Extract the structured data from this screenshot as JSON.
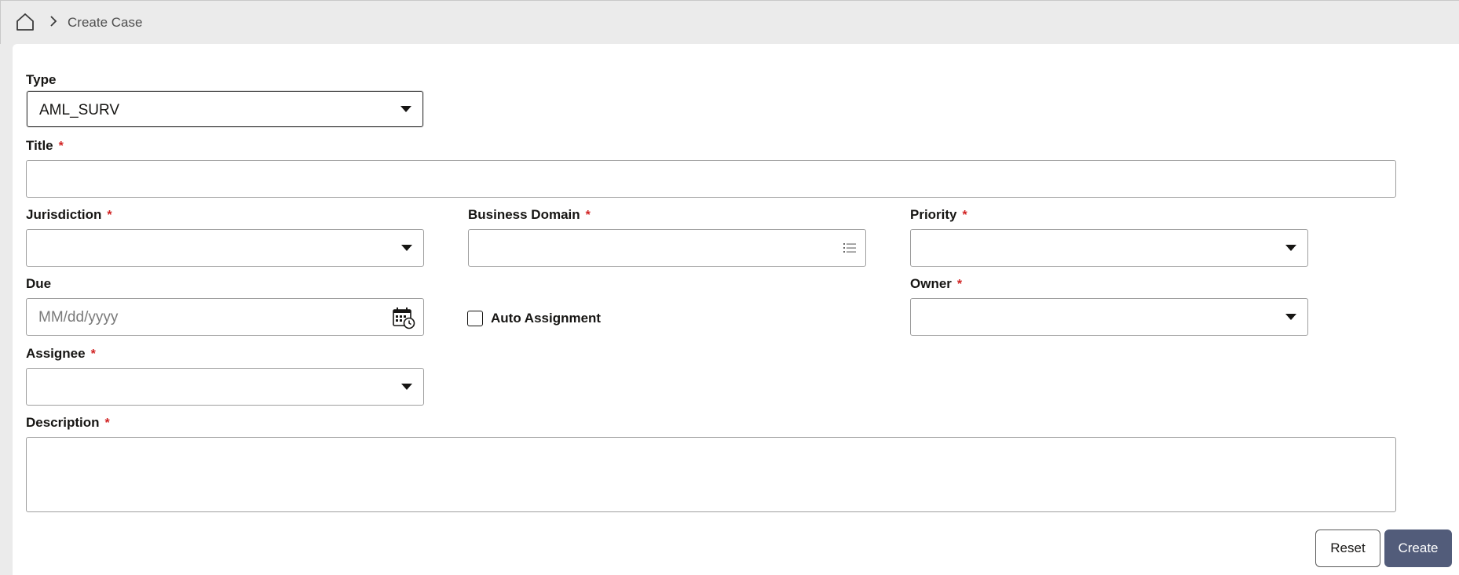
{
  "breadcrumb": {
    "home_icon": "home-icon",
    "separator_icon": "chevron-right-icon",
    "current": "Create Case"
  },
  "form": {
    "type": {
      "label": "Type",
      "value": "AML_SURV"
    },
    "title": {
      "label": "Title",
      "required_mark": "*",
      "value": ""
    },
    "jurisdiction": {
      "label": "Jurisdiction",
      "required_mark": "*",
      "value": ""
    },
    "business_domain": {
      "label": "Business Domain",
      "required_mark": "*",
      "value": ""
    },
    "priority": {
      "label": "Priority",
      "required_mark": "*",
      "value": ""
    },
    "due": {
      "label": "Due",
      "placeholder": "MM/dd/yyyy",
      "value": ""
    },
    "auto_assignment": {
      "label": "Auto Assignment",
      "checked": false
    },
    "owner": {
      "label": "Owner",
      "required_mark": "*",
      "value": ""
    },
    "assignee": {
      "label": "Assignee",
      "required_mark": "*",
      "value": ""
    },
    "description": {
      "label": "Description",
      "required_mark": "*",
      "value": ""
    }
  },
  "actions": {
    "reset_label": "Reset",
    "create_label": "Create"
  },
  "colors": {
    "required": "#d12121",
    "primary_button": "#525c7a",
    "page_background": "#ebebeb"
  }
}
